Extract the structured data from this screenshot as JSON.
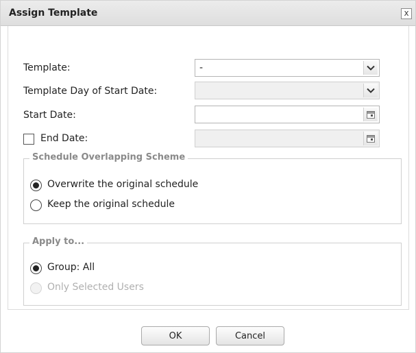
{
  "dialog": {
    "title": "Assign Template",
    "close_glyph": "x"
  },
  "form": {
    "template_label": "Template:",
    "template_value": "-",
    "template_day_label": "Template Day of Start Date:",
    "template_day_value": "",
    "start_date_label": "Start Date:",
    "start_date_value": "",
    "end_date_label": "End Date:",
    "end_date_value": "",
    "end_date_checked": false
  },
  "overlap": {
    "legend": "Schedule Overlapping Scheme",
    "options": [
      {
        "label": "Overwrite the original schedule",
        "checked": true
      },
      {
        "label": "Keep the original schedule",
        "checked": false
      }
    ]
  },
  "apply": {
    "legend": "Apply to...",
    "options": [
      {
        "label": "Group: All",
        "checked": true,
        "disabled": false
      },
      {
        "label": "Only Selected Users",
        "checked": false,
        "disabled": true
      }
    ]
  },
  "buttons": {
    "ok": "OK",
    "cancel": "Cancel"
  },
  "icons": [
    "chevron-down-icon",
    "calendar-icon",
    "close-icon"
  ]
}
